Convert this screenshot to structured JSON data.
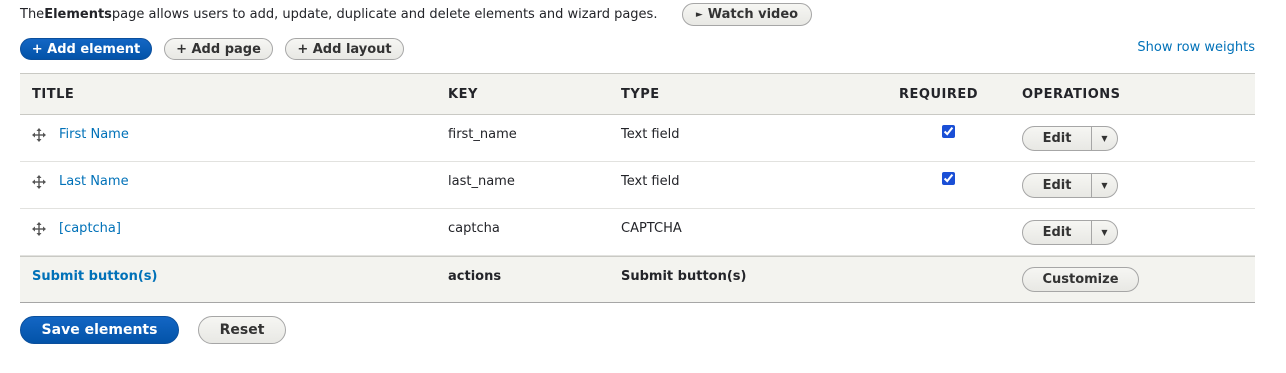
{
  "intro": {
    "prefix": "The ",
    "bold": "Elements",
    "suffix": " page allows users to add, update, duplicate and delete elements and wizard pages.",
    "watch_video": "Watch video"
  },
  "toolbar": {
    "add_element": "+ Add element",
    "add_page": "+ Add page",
    "add_layout": "+ Add layout",
    "show_row_weights": "Show row weights"
  },
  "table": {
    "headers": [
      "TITLE",
      "KEY",
      "TYPE",
      "REQUIRED",
      "OPERATIONS"
    ],
    "rows": [
      {
        "title": "First Name",
        "key": "first_name",
        "type": "Text field",
        "required": true,
        "op": "Edit"
      },
      {
        "title": "Last Name",
        "key": "last_name",
        "type": "Text field",
        "required": true,
        "op": "Edit"
      },
      {
        "title": "[captcha]",
        "key": "captcha",
        "type": "CAPTCHA",
        "required": false,
        "op": "Edit"
      }
    ],
    "submit_row": {
      "title": "Submit button(s)",
      "key": "actions",
      "type": "Submit button(s)",
      "op": "Customize"
    }
  },
  "actions": {
    "save": "Save elements",
    "reset": "Reset"
  },
  "colors": {
    "accent": "#0071b8",
    "primary_button": "#0353a8",
    "header_bg": "#f3f3ef"
  }
}
